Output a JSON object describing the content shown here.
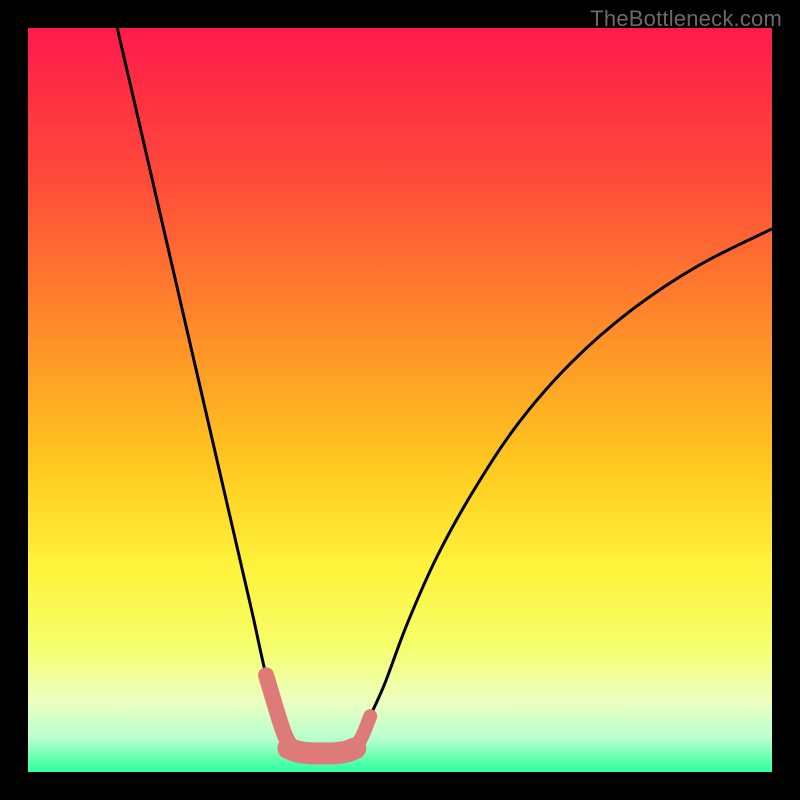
{
  "watermark": "TheBottleneck.com",
  "chart_data": {
    "type": "line",
    "title": "",
    "xlabel": "",
    "ylabel": "",
    "xlim": [
      0,
      100
    ],
    "ylim": [
      0,
      100
    ],
    "series": [
      {
        "name": "curve-left",
        "x": [
          12,
          15,
          18,
          21,
          24,
          27,
          30,
          32,
          33.5,
          34.5,
          35.5
        ],
        "y": [
          100,
          87,
          74,
          61,
          48,
          35,
          22,
          13,
          8,
          5,
          3.2
        ]
      },
      {
        "name": "curve-right",
        "x": [
          44,
          45,
          46,
          48,
          51,
          55,
          60,
          66,
          73,
          81,
          90,
          100
        ],
        "y": [
          3.2,
          5,
          7.5,
          12,
          20,
          29,
          38,
          47,
          55,
          62,
          68,
          73
        ]
      },
      {
        "name": "marker-trough",
        "x": [
          35,
          36,
          37,
          38,
          39,
          40,
          41,
          42,
          43,
          44
        ],
        "y": [
          3.2,
          2.8,
          2.6,
          2.5,
          2.5,
          2.5,
          2.5,
          2.6,
          2.8,
          3.2
        ]
      }
    ],
    "gradient_stops": [
      {
        "offset": 0.0,
        "color": "#ff1a4b"
      },
      {
        "offset": 0.2,
        "color": "#ff4a3a"
      },
      {
        "offset": 0.4,
        "color": "#ff8a2a"
      },
      {
        "offset": 0.58,
        "color": "#ffc61f"
      },
      {
        "offset": 0.72,
        "color": "#fff23a"
      },
      {
        "offset": 0.83,
        "color": "#f6ff6a"
      },
      {
        "offset": 0.905,
        "color": "#ecffc0"
      },
      {
        "offset": 0.955,
        "color": "#b8ffcf"
      },
      {
        "offset": 1.0,
        "color": "#2bff9e"
      }
    ],
    "marker_color": "#de7b79",
    "curve_color": "#000000"
  }
}
